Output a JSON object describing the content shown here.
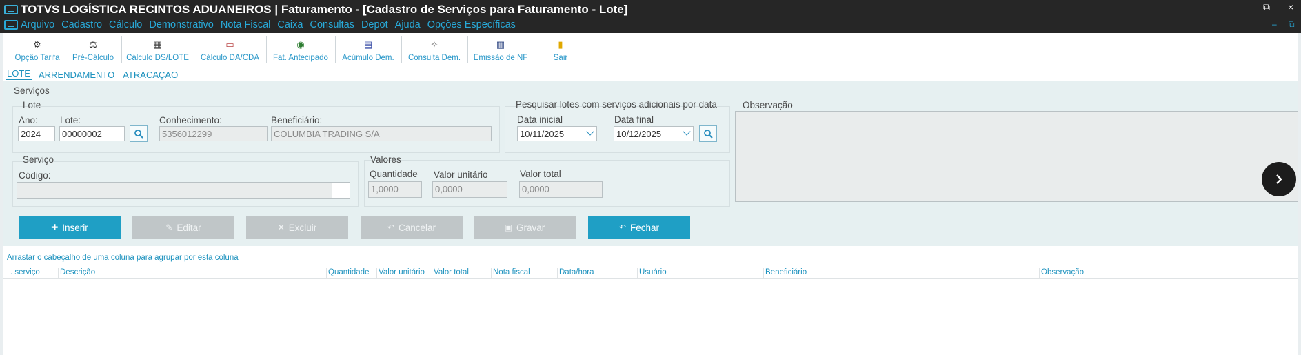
{
  "window": {
    "title": "TOTVS LOGÍSTICA RECINTOS ADUANEIROS | Faturamento - [Cadastro de Serviços para Faturamento - Lote]",
    "minimize": "–",
    "restore": "⧉",
    "close": "×"
  },
  "menu": [
    "Arquivo",
    "Cadastro",
    "Cálculo",
    "Demonstrativo",
    "Nota Fiscal",
    "Caixa",
    "Consultas",
    "Depot",
    "Ajuda",
    "Opções Específicas"
  ],
  "toolbar": [
    {
      "label": "Opção Tarifa",
      "icon": "tariff-icon",
      "glyph": "⚙"
    },
    {
      "label": "Pré-Cálculo",
      "icon": "pre-calc-icon",
      "glyph": "⚖"
    },
    {
      "label": "Cálculo DS/LOTE",
      "icon": "calculator-icon",
      "glyph": "▦"
    },
    {
      "label": "Cálculo DA/CDA",
      "icon": "calc-da-icon",
      "glyph": "▭"
    },
    {
      "label": "Fat. Antecipado",
      "icon": "globe-icon",
      "glyph": "◉"
    },
    {
      "label": "Acúmulo Dem.",
      "icon": "document-add-icon",
      "glyph": "▤"
    },
    {
      "label": "Consulta Dem.",
      "icon": "consulta-icon",
      "glyph": "✧"
    },
    {
      "label": "Emissão de NF",
      "icon": "invoice-icon",
      "glyph": "▥"
    },
    {
      "label": "Sair",
      "icon": "exit-icon",
      "glyph": "▮"
    }
  ],
  "tabs": [
    "LOTE",
    "ARRENDAMENTO",
    "ATRACAÇAO"
  ],
  "form": {
    "servicos_label": "Serviços",
    "lote_group": "Lote",
    "ano_label": "Ano:",
    "ano_value": "2024",
    "lote_label": "Lote:",
    "lote_value": "00000002",
    "conhecimento_label": "Conhecimento:",
    "conhecimento_value": "5356012299",
    "beneficiario_label": "Beneficiário:",
    "beneficiario_value": "COLUMBIA TRADING S/A",
    "pesquisar_label": "Pesquisar lotes com serviços adicionais por data",
    "data_inicial_label": "Data inicial",
    "data_inicial_value": "10/11/2025",
    "data_final_label": "Data final",
    "data_final_value": "10/12/2025",
    "observacao_label": "Observação",
    "servico_group": "Serviço",
    "codigo_label": "Código:",
    "valores_group": "Valores",
    "quantidade_label": "Quantidade",
    "quantidade_value": "1,0000",
    "valor_unitario_label": "Valor unitário",
    "valor_unitario_value": "0,0000",
    "valor_total_label": "Valor total",
    "valor_total_value": "0,0000"
  },
  "actions": {
    "inserir": "Inserir",
    "editar": "Editar",
    "excluir": "Excluir",
    "cancelar": "Cancelar",
    "gravar": "Gravar",
    "fechar": "Fechar"
  },
  "grid": {
    "group_hint": "Arrastar o cabeçalho de uma coluna para agrupar por esta coluna",
    "columns": [
      ". serviço",
      "Descrição",
      "Quantidade",
      "Valor unitário",
      "Valor total",
      "Nota fiscal",
      "Data/hora",
      "Usuário",
      "Beneficiário",
      "Observação"
    ]
  },
  "colors": {
    "accent": "#1f9fc5",
    "titlebar": "#262626",
    "menu_text": "#28a9d8",
    "panel": "#e6f0f1"
  }
}
